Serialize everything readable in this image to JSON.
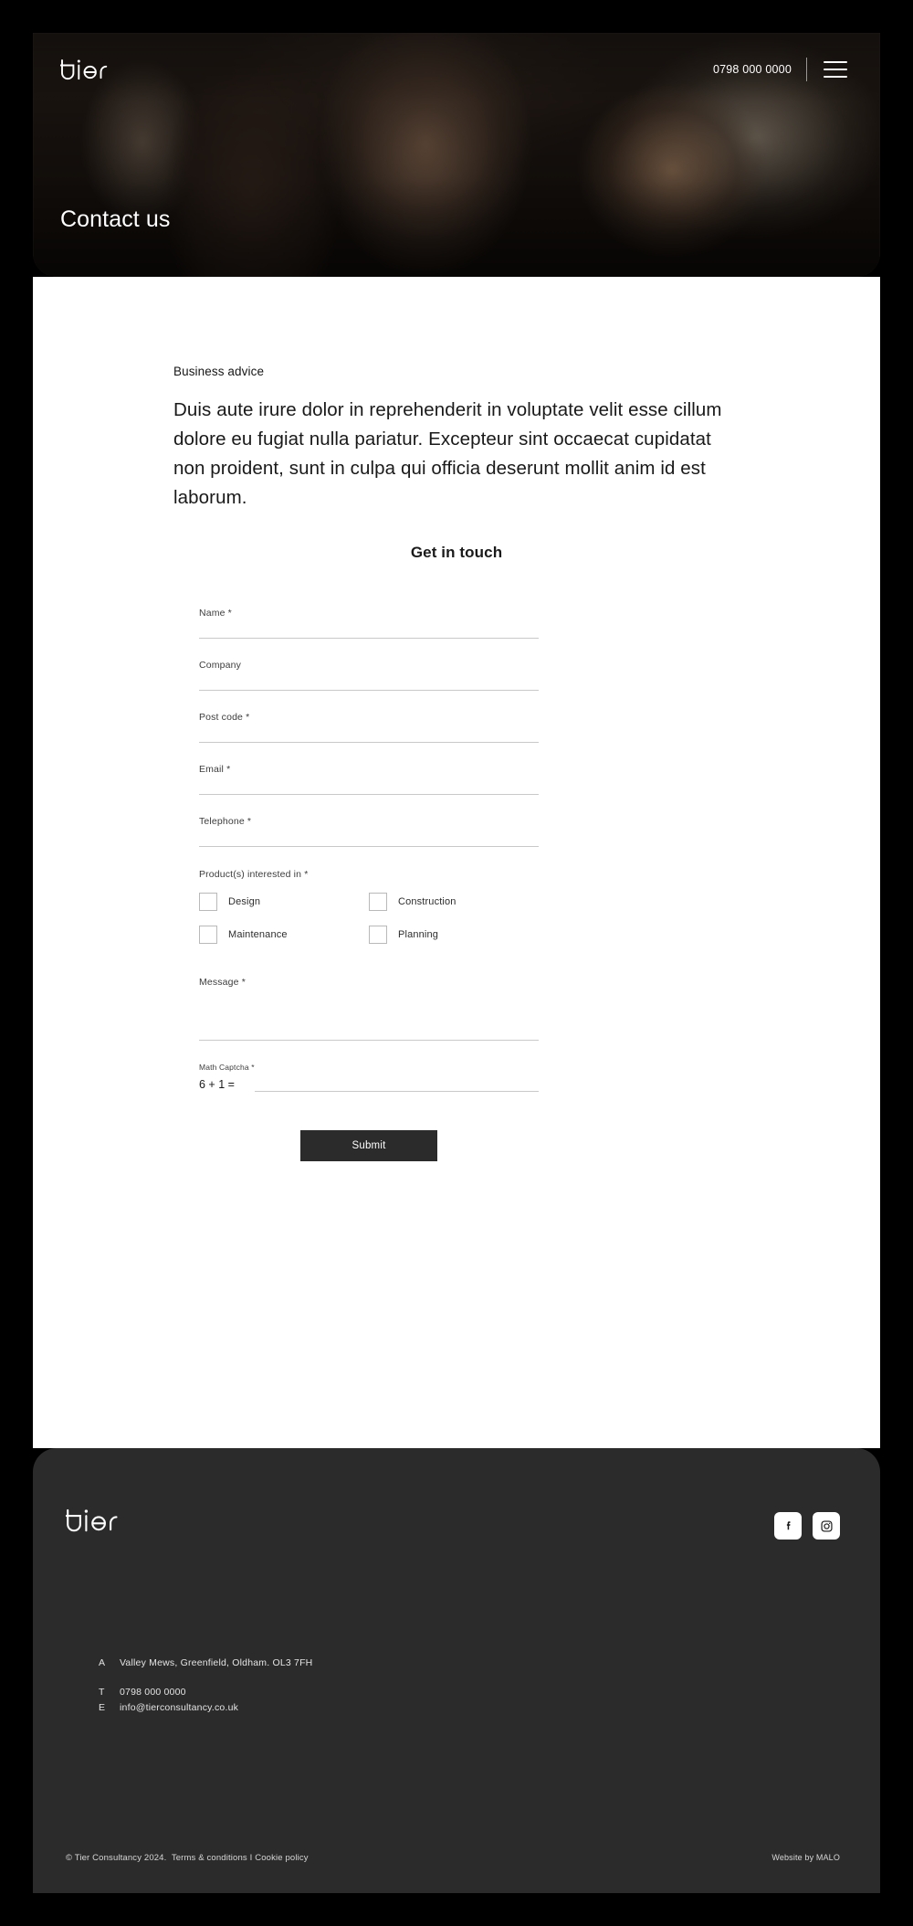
{
  "brand": {
    "name": "tier"
  },
  "header": {
    "logo_alt": "tier",
    "phone": "0798 000 0000",
    "menu_icon": "hamburger-icon",
    "page_title": "Contact us"
  },
  "main": {
    "eyebrow": "Business advice",
    "lead": "Duis aute irure dolor in reprehenderit in voluptate velit esse cillum dolore eu fugiat nulla pariatur. Excepteur sint occaecat cupidatat non proident, sunt in culpa qui officia deserunt mollit anim id est laborum.",
    "form": {
      "heading": "Get in touch",
      "fields": [
        {
          "label": "Name *",
          "value": "",
          "placeholder": ""
        },
        {
          "label": "Company",
          "value": "",
          "placeholder": ""
        },
        {
          "label": "Post code *",
          "value": "",
          "placeholder": ""
        },
        {
          "label": "Email *",
          "value": "",
          "placeholder": ""
        },
        {
          "label": "Telephone *",
          "value": "",
          "placeholder": ""
        }
      ],
      "products_label": "Product(s) interested in *",
      "products": [
        {
          "label": "Design",
          "checked": false
        },
        {
          "label": "Construction",
          "checked": false
        },
        {
          "label": "Maintenance",
          "checked": false
        },
        {
          "label": "Planning",
          "checked": false
        }
      ],
      "message_label": "Message *",
      "message_value": "",
      "captcha_label": "Math Captcha *",
      "captcha_question": "6 + 1 =",
      "captcha_value": "",
      "submit_label": "Submit"
    }
  },
  "footer": {
    "logo_alt": "tier",
    "social": [
      {
        "name": "facebook-icon",
        "label": "Facebook"
      },
      {
        "name": "instagram-icon",
        "label": "Instagram"
      }
    ],
    "contact": [
      {
        "key": "A",
        "value": "Valley Mews, Greenfield, Oldham. OL3 7FH"
      },
      {
        "key": "T",
        "value": "0798 000 0000"
      },
      {
        "key": "E",
        "value": "info@tierconsultancy.co.uk"
      }
    ],
    "copyright": "© Tier Consultancy 2024.",
    "terms_label": "Terms & conditions",
    "separator": "I",
    "cookie_label": "Cookie policy",
    "credit": "Website by MALO"
  },
  "colors": {
    "page_background": "#000000",
    "card_background": "#ffffff",
    "footer_background": "#2b2b2b",
    "submit_background": "#2b2b2b",
    "text_dark": "#1a1a1a",
    "text_light": "#e4e4e4",
    "rule": "#c9c9c9"
  }
}
